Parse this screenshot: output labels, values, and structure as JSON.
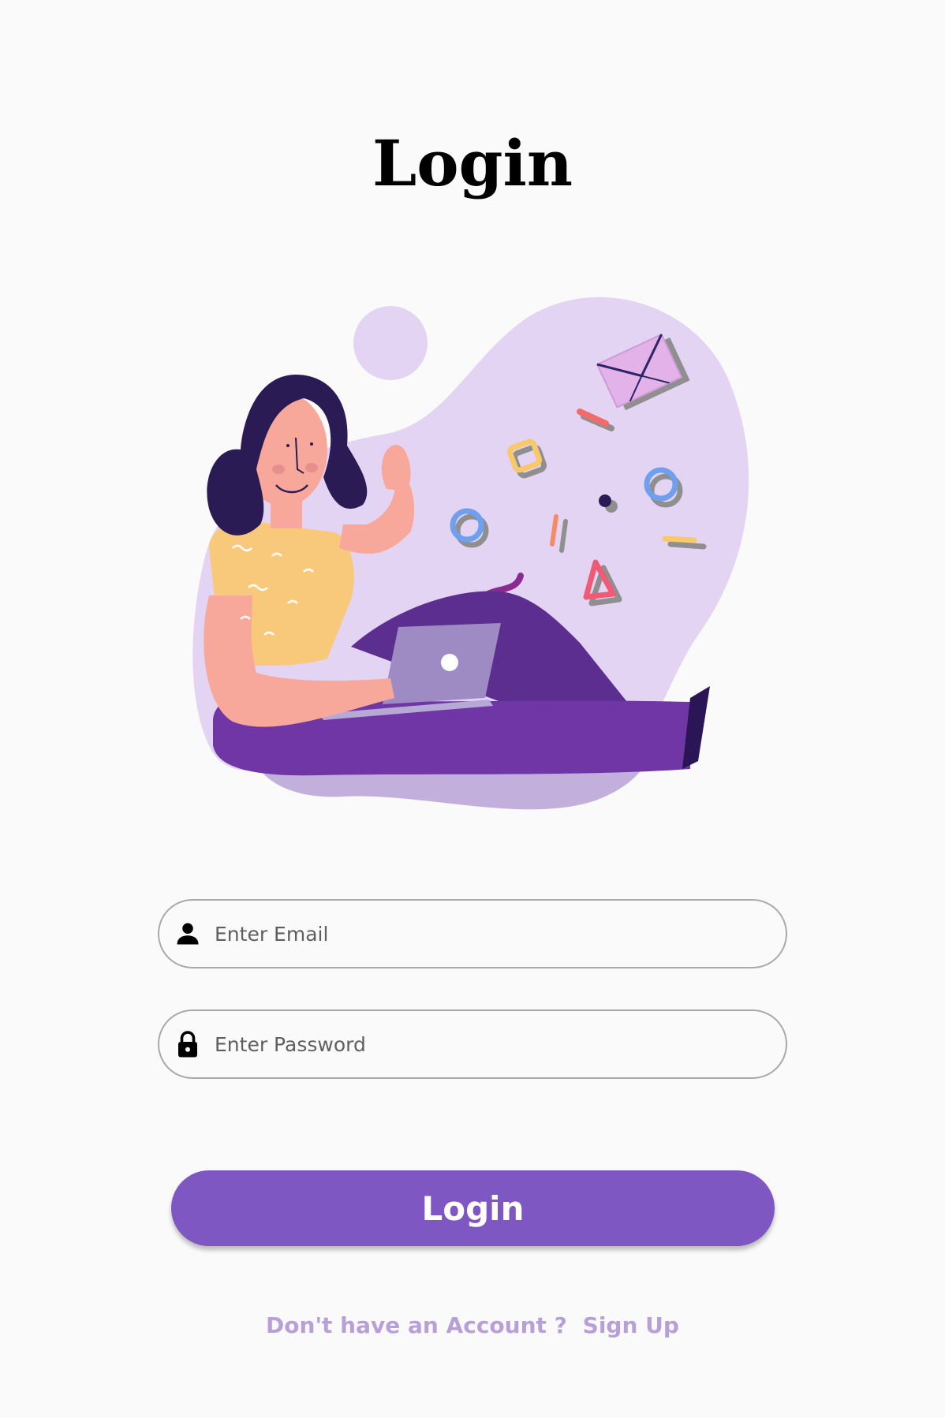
{
  "page": {
    "title": "Login"
  },
  "form": {
    "email": {
      "placeholder": "Enter Email",
      "icon": "person-icon"
    },
    "password": {
      "placeholder": "Enter Password",
      "icon": "lock-icon"
    },
    "submit_label": "Login"
  },
  "footer": {
    "prompt": "Don't have an Account ?",
    "signup_link": "Sign Up"
  },
  "colors": {
    "primary": "#7f57c2",
    "link": "#b7a0d8",
    "background": "#fafafa",
    "field_border": "#a9a9a9"
  }
}
